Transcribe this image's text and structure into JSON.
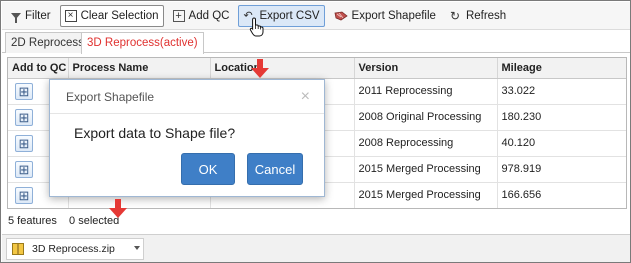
{
  "toolbar": {
    "filter": "Filter",
    "clear_selection": "Clear Selection",
    "add_qc": "Add QC",
    "export_csv": "Export CSV",
    "export_shapefile": "Export Shapefile",
    "refresh": "Refresh"
  },
  "tabs": [
    {
      "label": "2D Reprocess"
    },
    {
      "label": "3D Reprocess(active)"
    }
  ],
  "table": {
    "headers": [
      "Add to QC",
      "Process Name",
      "Location",
      "Version",
      "Mileage"
    ],
    "rows": [
      {
        "version": "2011 Reprocessing",
        "mileage": "33.022"
      },
      {
        "version": "2008 Original Processing",
        "mileage": "180.230"
      },
      {
        "version": "2008 Reprocessing",
        "mileage": "40.120"
      },
      {
        "version": "2015 Merged Processing",
        "mileage": "978.919"
      },
      {
        "version": "2015 Merged Processing",
        "mileage": "166.656"
      }
    ]
  },
  "status": {
    "features": "5 features",
    "selected": "0 selected"
  },
  "dialog": {
    "title": "Export Shapefile",
    "message": "Export data to Shape file?",
    "ok": "OK",
    "cancel": "Cancel",
    "close": "×"
  },
  "download": {
    "filename": "3D Reprocess.zip"
  },
  "colors": {
    "accent": "#3f7fc7",
    "active_tab": "#e0312f",
    "annotation_arrow": "#e53935"
  }
}
